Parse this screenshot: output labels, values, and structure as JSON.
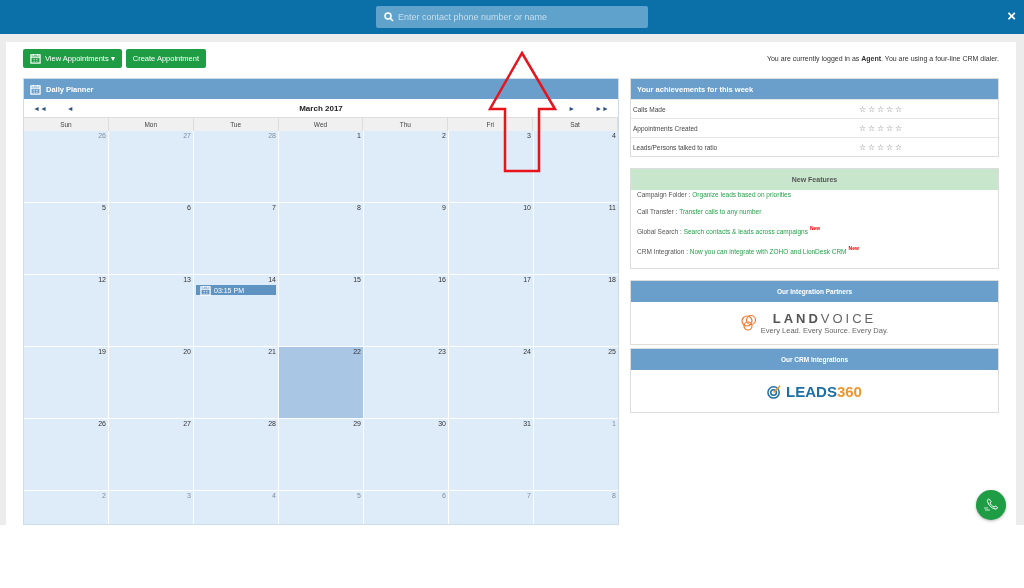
{
  "top_bar": {
    "search": {
      "placeholder": "Enter contact phone number or name"
    },
    "close": "×"
  },
  "toolbar": {
    "buttons": [
      {
        "label": "View Appointments",
        "kind": "dropdown",
        "caret": "▾"
      },
      {
        "label": "Create Appointment",
        "kind": "plain"
      }
    ],
    "login_note": "You are currently logged in as **Agent**. You are using a four-line CRM dialer."
  },
  "planner": {
    "title": "Daily Planner",
    "nav": {
      "first": "◄◄",
      "prev": "◄",
      "next": "►",
      "last": "►►"
    },
    "month": "March 2017",
    "weekdays": [
      "Sun",
      "Mon",
      "Tue",
      "Wed",
      "Thu",
      "Fri",
      "Sat"
    ],
    "weeks": [
      [
        {
          "day": "26",
          "other_month": true,
          "today": false
        },
        {
          "day": "27",
          "other_month": true,
          "today": false
        },
        {
          "day": "28",
          "other_month": true,
          "today": false
        },
        {
          "day": "1",
          "other_month": false,
          "today": false
        },
        {
          "day": "2",
          "other_month": false,
          "today": false
        },
        {
          "day": "3",
          "other_month": false,
          "today": false
        },
        {
          "day": "4",
          "other_month": false,
          "today": false
        }
      ],
      [
        {
          "day": "5",
          "other_month": false,
          "today": false
        },
        {
          "day": "6",
          "other_month": false,
          "today": false
        },
        {
          "day": "7",
          "other_month": false,
          "today": false
        },
        {
          "day": "8",
          "other_month": false,
          "today": false
        },
        {
          "day": "9",
          "other_month": false,
          "today": false
        },
        {
          "day": "10",
          "other_month": false,
          "today": false
        },
        {
          "day": "11",
          "other_month": false,
          "today": false
        }
      ],
      [
        {
          "day": "12",
          "other_month": false,
          "today": false
        },
        {
          "day": "13",
          "other_month": false,
          "today": false
        },
        {
          "day": "14",
          "other_month": false,
          "today": false,
          "events": [
            "03:15 PM"
          ]
        },
        {
          "day": "15",
          "other_month": false,
          "today": false
        },
        {
          "day": "16",
          "other_month": false,
          "today": false
        },
        {
          "day": "17",
          "other_month": false,
          "today": false
        },
        {
          "day": "18",
          "other_month": false,
          "today": false
        }
      ],
      [
        {
          "day": "19",
          "other_month": false,
          "today": false
        },
        {
          "day": "20",
          "other_month": false,
          "today": false
        },
        {
          "day": "21",
          "other_month": false,
          "today": false
        },
        {
          "day": "22",
          "other_month": false,
          "today": true
        },
        {
          "day": "23",
          "other_month": false,
          "today": false
        },
        {
          "day": "24",
          "other_month": false,
          "today": false
        },
        {
          "day": "25",
          "other_month": false,
          "today": false
        }
      ],
      [
        {
          "day": "26",
          "other_month": false,
          "today": false
        },
        {
          "day": "27",
          "other_month": false,
          "today": false
        },
        {
          "day": "28",
          "other_month": false,
          "today": false
        },
        {
          "day": "29",
          "other_month": false,
          "today": false
        },
        {
          "day": "30",
          "other_month": false,
          "today": false
        },
        {
          "day": "31",
          "other_month": false,
          "today": false
        },
        {
          "day": "1",
          "other_month": true,
          "today": false
        }
      ],
      [
        {
          "day": "2",
          "other_month": true,
          "today": false
        },
        {
          "day": "3",
          "other_month": true,
          "today": false
        },
        {
          "day": "4",
          "other_month": true,
          "today": false
        },
        {
          "day": "5",
          "other_month": true,
          "today": false
        },
        {
          "day": "6",
          "other_month": true,
          "today": false
        },
        {
          "day": "7",
          "other_month": true,
          "today": false
        },
        {
          "day": "8",
          "other_month": true,
          "today": false
        }
      ]
    ]
  },
  "achievements": {
    "title": "Your achievements for this week",
    "rows": [
      {
        "label": "Calls Made",
        "stars": 0
      },
      {
        "label": "Appointments Created",
        "stars": 0
      },
      {
        "label": "Leads/Persons talked to ratio",
        "stars": 0
      }
    ]
  },
  "new_features": {
    "title": "New Features",
    "items": [
      {
        "name": "Campaign Folder :",
        "description": "Organize leads based on priorities"
      },
      {
        "name": "Call Transfer :",
        "description": "Transfer calls to any number"
      },
      {
        "name": "Global Search :",
        "description": "Search contacts & leads across campaigns",
        "badge": "New"
      },
      {
        "name": "CRM Integration :",
        "description": "Now you can integrate with ZOHO and LionDesk CRM",
        "badge": "New"
      }
    ]
  },
  "partners": {
    "title": "Our Integration Partners",
    "logo": {
      "bold": "LAND",
      "light": "VOICE",
      "tagline": "Every Lead. Every Source. Every Day."
    }
  },
  "crm": {
    "title": "Our CRM Integrations",
    "logo": {
      "first": "LEADS",
      "second": "360"
    }
  }
}
